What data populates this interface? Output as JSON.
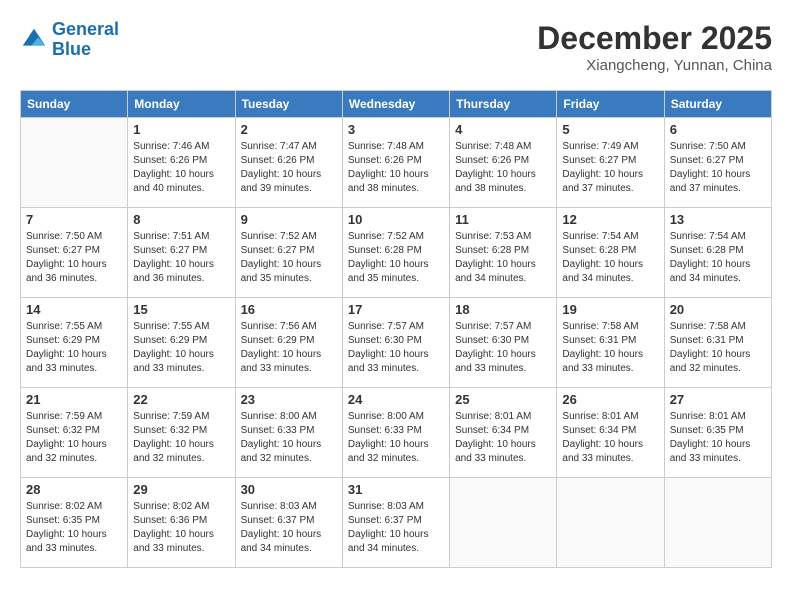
{
  "header": {
    "logo_line1": "General",
    "logo_line2": "Blue",
    "month": "December 2025",
    "location": "Xiangcheng, Yunnan, China"
  },
  "weekdays": [
    "Sunday",
    "Monday",
    "Tuesday",
    "Wednesday",
    "Thursday",
    "Friday",
    "Saturday"
  ],
  "weeks": [
    [
      {
        "day": "",
        "info": ""
      },
      {
        "day": "1",
        "info": "Sunrise: 7:46 AM\nSunset: 6:26 PM\nDaylight: 10 hours\nand 40 minutes."
      },
      {
        "day": "2",
        "info": "Sunrise: 7:47 AM\nSunset: 6:26 PM\nDaylight: 10 hours\nand 39 minutes."
      },
      {
        "day": "3",
        "info": "Sunrise: 7:48 AM\nSunset: 6:26 PM\nDaylight: 10 hours\nand 38 minutes."
      },
      {
        "day": "4",
        "info": "Sunrise: 7:48 AM\nSunset: 6:26 PM\nDaylight: 10 hours\nand 38 minutes."
      },
      {
        "day": "5",
        "info": "Sunrise: 7:49 AM\nSunset: 6:27 PM\nDaylight: 10 hours\nand 37 minutes."
      },
      {
        "day": "6",
        "info": "Sunrise: 7:50 AM\nSunset: 6:27 PM\nDaylight: 10 hours\nand 37 minutes."
      }
    ],
    [
      {
        "day": "7",
        "info": "Sunrise: 7:50 AM\nSunset: 6:27 PM\nDaylight: 10 hours\nand 36 minutes."
      },
      {
        "day": "8",
        "info": "Sunrise: 7:51 AM\nSunset: 6:27 PM\nDaylight: 10 hours\nand 36 minutes."
      },
      {
        "day": "9",
        "info": "Sunrise: 7:52 AM\nSunset: 6:27 PM\nDaylight: 10 hours\nand 35 minutes."
      },
      {
        "day": "10",
        "info": "Sunrise: 7:52 AM\nSunset: 6:28 PM\nDaylight: 10 hours\nand 35 minutes."
      },
      {
        "day": "11",
        "info": "Sunrise: 7:53 AM\nSunset: 6:28 PM\nDaylight: 10 hours\nand 34 minutes."
      },
      {
        "day": "12",
        "info": "Sunrise: 7:54 AM\nSunset: 6:28 PM\nDaylight: 10 hours\nand 34 minutes."
      },
      {
        "day": "13",
        "info": "Sunrise: 7:54 AM\nSunset: 6:28 PM\nDaylight: 10 hours\nand 34 minutes."
      }
    ],
    [
      {
        "day": "14",
        "info": "Sunrise: 7:55 AM\nSunset: 6:29 PM\nDaylight: 10 hours\nand 33 minutes."
      },
      {
        "day": "15",
        "info": "Sunrise: 7:55 AM\nSunset: 6:29 PM\nDaylight: 10 hours\nand 33 minutes."
      },
      {
        "day": "16",
        "info": "Sunrise: 7:56 AM\nSunset: 6:29 PM\nDaylight: 10 hours\nand 33 minutes."
      },
      {
        "day": "17",
        "info": "Sunrise: 7:57 AM\nSunset: 6:30 PM\nDaylight: 10 hours\nand 33 minutes."
      },
      {
        "day": "18",
        "info": "Sunrise: 7:57 AM\nSunset: 6:30 PM\nDaylight: 10 hours\nand 33 minutes."
      },
      {
        "day": "19",
        "info": "Sunrise: 7:58 AM\nSunset: 6:31 PM\nDaylight: 10 hours\nand 33 minutes."
      },
      {
        "day": "20",
        "info": "Sunrise: 7:58 AM\nSunset: 6:31 PM\nDaylight: 10 hours\nand 32 minutes."
      }
    ],
    [
      {
        "day": "21",
        "info": "Sunrise: 7:59 AM\nSunset: 6:32 PM\nDaylight: 10 hours\nand 32 minutes."
      },
      {
        "day": "22",
        "info": "Sunrise: 7:59 AM\nSunset: 6:32 PM\nDaylight: 10 hours\nand 32 minutes."
      },
      {
        "day": "23",
        "info": "Sunrise: 8:00 AM\nSunset: 6:33 PM\nDaylight: 10 hours\nand 32 minutes."
      },
      {
        "day": "24",
        "info": "Sunrise: 8:00 AM\nSunset: 6:33 PM\nDaylight: 10 hours\nand 32 minutes."
      },
      {
        "day": "25",
        "info": "Sunrise: 8:01 AM\nSunset: 6:34 PM\nDaylight: 10 hours\nand 33 minutes."
      },
      {
        "day": "26",
        "info": "Sunrise: 8:01 AM\nSunset: 6:34 PM\nDaylight: 10 hours\nand 33 minutes."
      },
      {
        "day": "27",
        "info": "Sunrise: 8:01 AM\nSunset: 6:35 PM\nDaylight: 10 hours\nand 33 minutes."
      }
    ],
    [
      {
        "day": "28",
        "info": "Sunrise: 8:02 AM\nSunset: 6:35 PM\nDaylight: 10 hours\nand 33 minutes."
      },
      {
        "day": "29",
        "info": "Sunrise: 8:02 AM\nSunset: 6:36 PM\nDaylight: 10 hours\nand 33 minutes."
      },
      {
        "day": "30",
        "info": "Sunrise: 8:03 AM\nSunset: 6:37 PM\nDaylight: 10 hours\nand 34 minutes."
      },
      {
        "day": "31",
        "info": "Sunrise: 8:03 AM\nSunset: 6:37 PM\nDaylight: 10 hours\nand 34 minutes."
      },
      {
        "day": "",
        "info": ""
      },
      {
        "day": "",
        "info": ""
      },
      {
        "day": "",
        "info": ""
      }
    ]
  ]
}
